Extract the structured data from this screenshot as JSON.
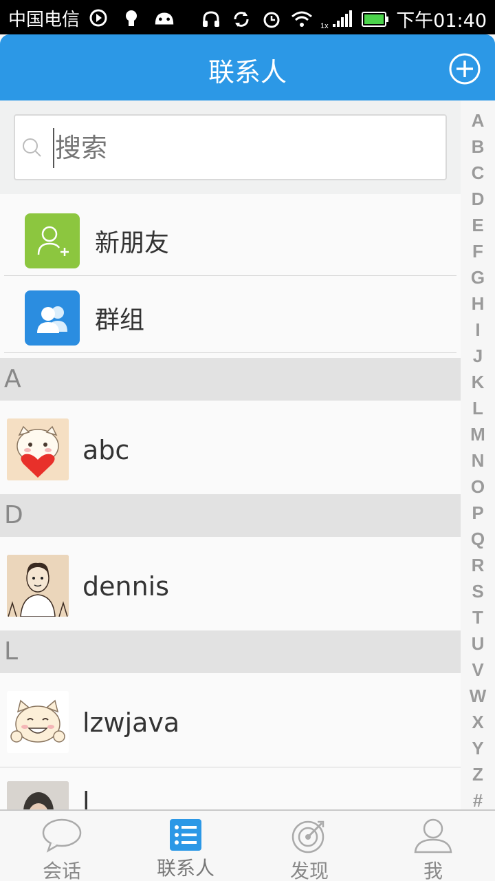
{
  "status_bar": {
    "carrier": "中国电信",
    "time": "下午01:40",
    "signal_label": "1x"
  },
  "header": {
    "title": "联系人",
    "add_icon": "plus-circle-icon"
  },
  "search": {
    "placeholder": "搜索"
  },
  "fixed_items": [
    {
      "label": "新朋友",
      "icon": "add-friend-icon",
      "color": "#8cc63f"
    },
    {
      "label": "群组",
      "icon": "group-icon",
      "color": "#2b8de0"
    }
  ],
  "sections": [
    {
      "letter": "A",
      "contacts": [
        {
          "name": "abc"
        }
      ]
    },
    {
      "letter": "D",
      "contacts": [
        {
          "name": "dennis"
        }
      ]
    },
    {
      "letter": "L",
      "contacts": [
        {
          "name": "lzwjava"
        },
        {
          "name": "l"
        }
      ]
    }
  ],
  "index_letters": [
    "A",
    "B",
    "C",
    "D",
    "E",
    "F",
    "G",
    "H",
    "I",
    "J",
    "K",
    "L",
    "M",
    "N",
    "O",
    "P",
    "Q",
    "R",
    "S",
    "T",
    "U",
    "V",
    "W",
    "X",
    "Y",
    "Z",
    "#"
  ],
  "bottom_nav": [
    {
      "label": "会话",
      "icon": "chat-bubble-icon",
      "active": false
    },
    {
      "label": "联系人",
      "icon": "contact-list-icon",
      "active": true
    },
    {
      "label": "发现",
      "icon": "discover-icon",
      "active": false
    },
    {
      "label": "我",
      "icon": "profile-icon",
      "active": false
    }
  ],
  "colors": {
    "primary": "#2c98e6",
    "section_bg": "#e2e2e2"
  }
}
